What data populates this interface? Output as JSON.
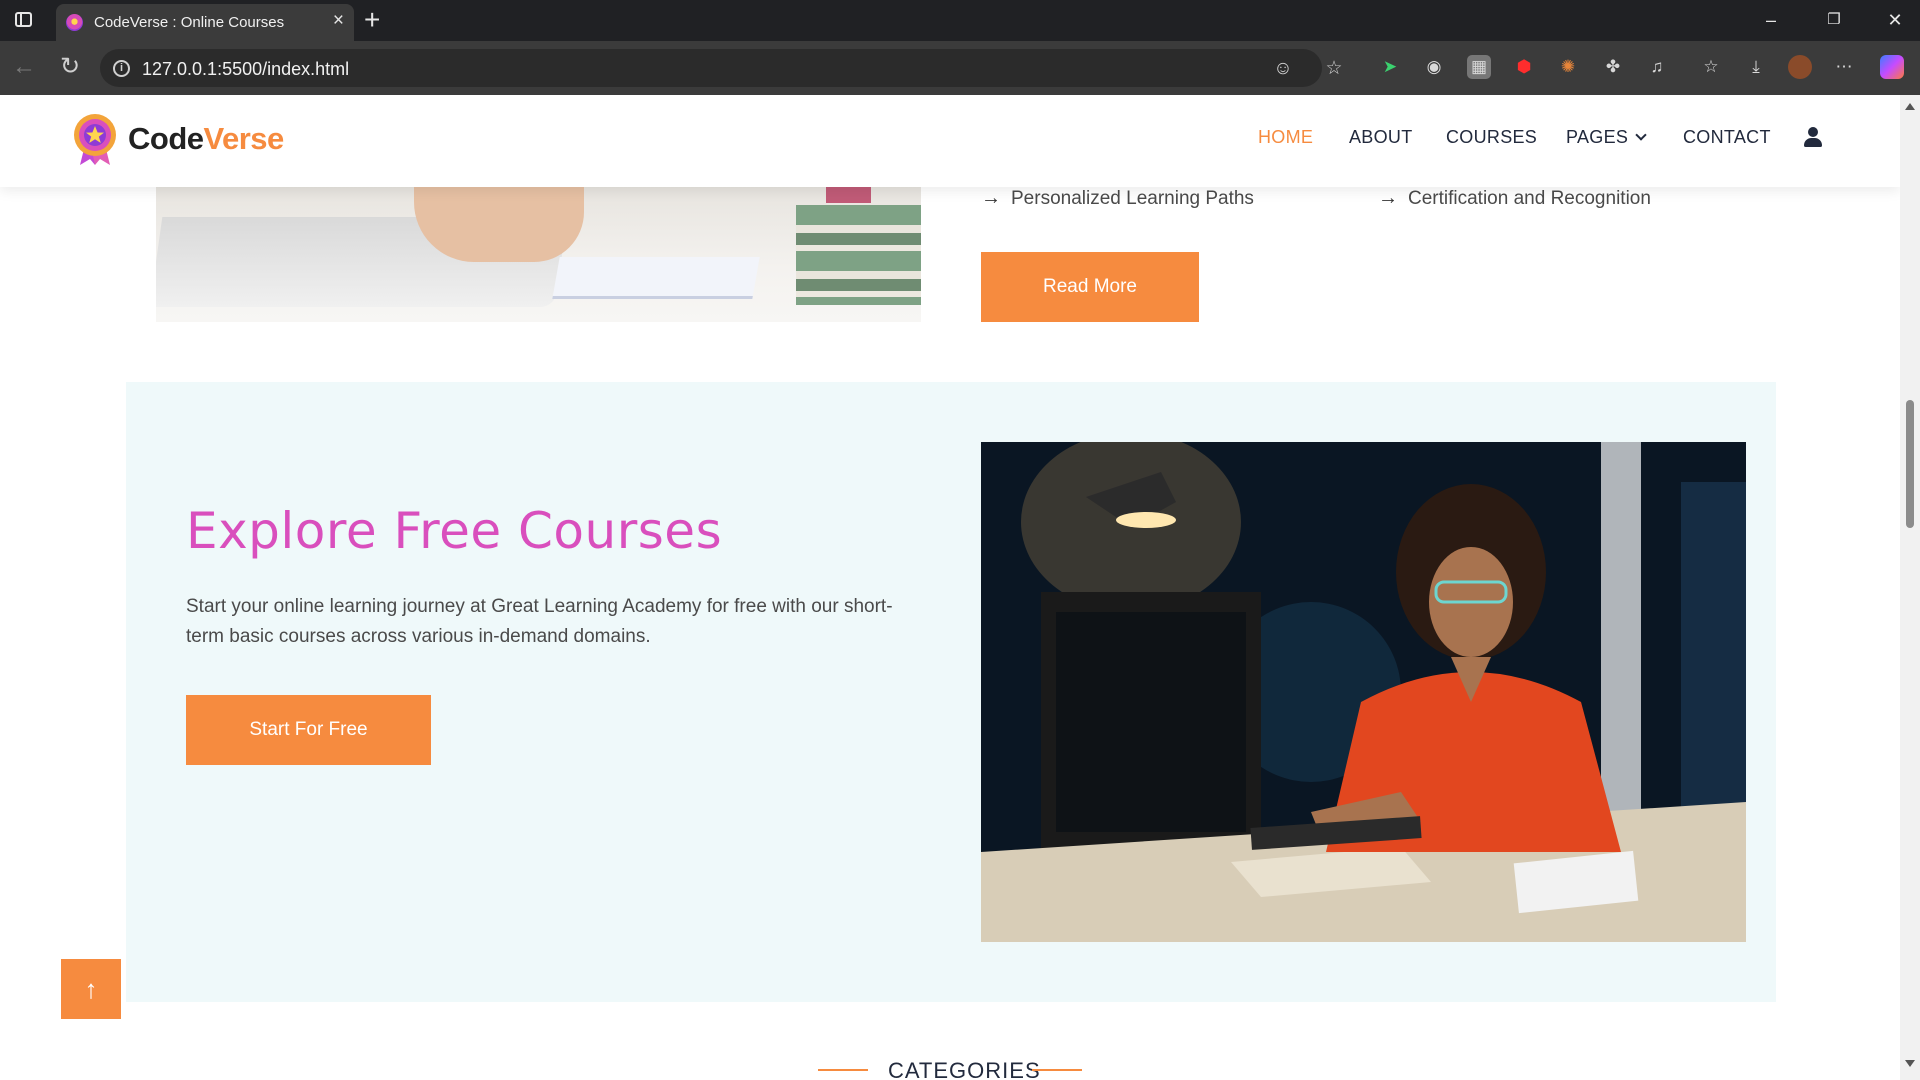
{
  "browser": {
    "tab_title": "CodeVerse : Online Courses",
    "url": "127.0.0.1:5500/index.html",
    "window_buttons": [
      "minimize-icon",
      "restore-icon",
      "close-icon"
    ]
  },
  "header": {
    "logo_code": "Code",
    "logo_verse": "Verse",
    "nav": [
      "HOME",
      "ABOUT",
      "COURSES",
      "PAGES",
      "CONTACT"
    ],
    "active_nav": "HOME"
  },
  "about": {
    "features": [
      "Personalized Learning Paths",
      "Certification and Recognition"
    ],
    "read_more_label": "Read More"
  },
  "free_courses": {
    "title": "Explore Free Courses",
    "description": "Start your online learning journey at Great Learning Academy for free with our short-term basic courses across various in-demand domains.",
    "button_label": "Start For Free"
  },
  "categories": {
    "heading": "CATEGORIES"
  },
  "colors": {
    "accent": "#f68b3f",
    "title_pink": "#d94fbd",
    "section_bg": "#eff9fa",
    "nav_text": "#222a3d"
  }
}
